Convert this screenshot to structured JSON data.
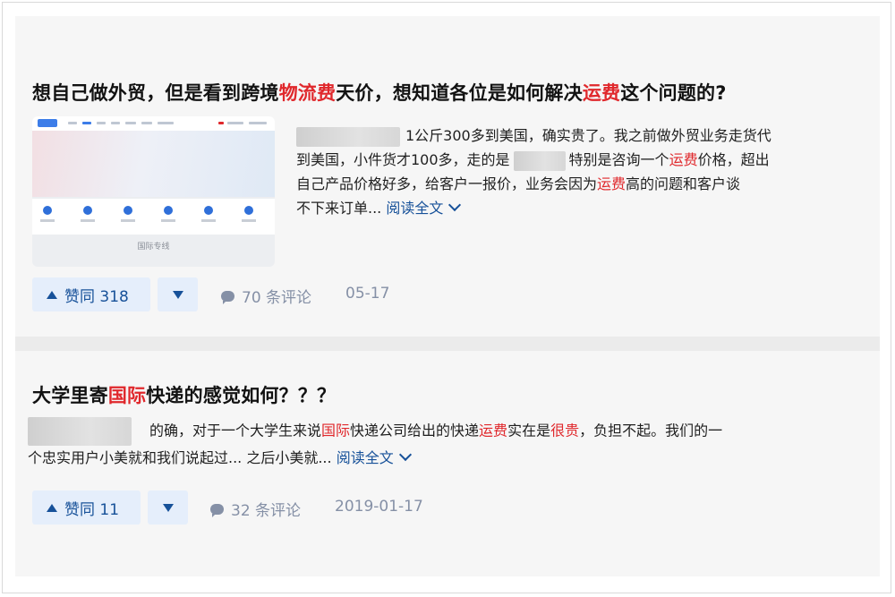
{
  "item1": {
    "title_a": "想自己做外贸，但是看到跨境",
    "title_hl1": "物流费",
    "title_b": "天价，想知道各位是如何解决",
    "title_hl2": "运费",
    "title_c": "这个问题的?",
    "thumb_caption": "国际专线",
    "line1": "1公斤300多到美国，确实贵了。我之前做外贸业务走货代",
    "line2_a": "到美国，小件货才100多，走的是",
    "line2_b": "特别是咨询一个",
    "line2_hl": "运费",
    "line2_c": "价格，超出",
    "line3_a": "自己产品价格好多，给客户一报价，业务会因为",
    "line3_hl": "运费",
    "line3_b": "高的问题和客户谈",
    "line4": "不下来订单...",
    "read_more": "阅读全文",
    "vote_label": "赞同 318",
    "comments": "70 条评论",
    "date": "05-17"
  },
  "item2": {
    "title_a": "大学里寄",
    "title_hl": "国际",
    "title_b": "快递的感觉如何？？？",
    "line1_a": "的确，对于一个大学生来说",
    "line1_hl1": "国际",
    "line1_b": "快递公司给出的快递",
    "line1_hl2": "运费",
    "line1_c": "实在是",
    "line1_hl3": "很贵",
    "line1_d": "，负担不起。我们的一",
    "line2": "个忠实用户小美就和我们说起过... 之后小美就...",
    "read_more": "阅读全文",
    "vote_label": "赞同 11",
    "comments": "32 条评论",
    "date": "2019-01-17"
  },
  "colors": {
    "highlight": "#e0282c",
    "link": "#175199",
    "vote_bg": "#e5eefb",
    "meta": "#8590a6"
  }
}
